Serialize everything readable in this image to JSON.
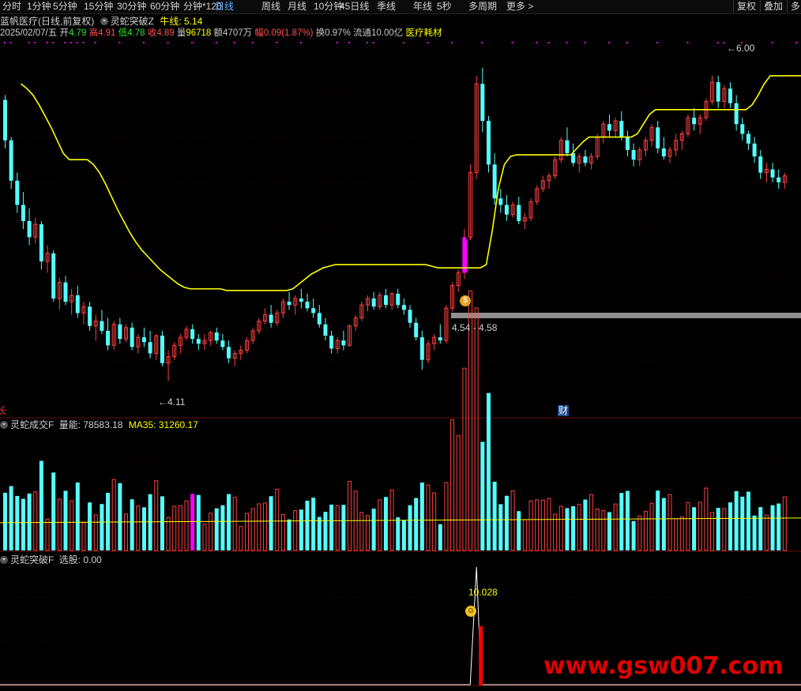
{
  "toolbar": {
    "tabs": [
      "分时",
      "1分钟",
      "5分钟",
      "15分钟",
      "30分钟",
      "60分钟",
      "分钟*120",
      "日线",
      "周线",
      "月线",
      "10分钟",
      "45日线",
      "季线",
      "年线",
      "5秒",
      "多周期",
      "更多"
    ],
    "active": "日线",
    "more_arrow": ">",
    "right_buttons": [
      "复权",
      "叠加",
      "多"
    ]
  },
  "header": {
    "stock": "蓝帆医疗(日线,前复权)",
    "indicator": "灵蛇突破Z",
    "bull_label": "牛线:",
    "bull_value": "5.14",
    "date": "2025/02/07/五",
    "open_label": "开",
    "open": "4.79",
    "high_label": "高",
    "high": "4.91",
    "low_label": "低",
    "low": "4.78",
    "close_label": "收",
    "close": "4.89",
    "vol_label": "量",
    "vol": "96718",
    "amount_label": "额",
    "amount": "4707万",
    "change_label": "幅",
    "change": "0.09(1.87%)",
    "turnover_label": "换",
    "turnover": "0.97%",
    "float_label": "流通",
    "float": "10.00亿",
    "sector": "医疗耗材"
  },
  "annotations": {
    "high_price": "6.00",
    "low_price": "4.11",
    "band": "4.54 - 4.58",
    "cai": "财",
    "left_mark": "长"
  },
  "volume_panel": {
    "indicator": "灵蛇成交F",
    "vol_label": "量能:",
    "vol_value": "78583.18",
    "ma_label": "MA35:",
    "ma_value": "31260.17"
  },
  "signal_panel": {
    "indicator": "灵蛇突破F",
    "pick_label": "选股:",
    "pick_value": "0.00",
    "peak_value": "10.028"
  },
  "watermark": "www.gsw007.com",
  "colors": {
    "up": "#ff4040",
    "down": "#54ffff",
    "bull_line": "#ffff00",
    "signal_bar": "#ff00ff",
    "grid": "#5a0a0a"
  },
  "chart_data": {
    "type": "candlestick",
    "price_range": [
      3.95,
      6.2
    ],
    "ohlc": [
      [
        5.85,
        5.88,
        5.55,
        5.6
      ],
      [
        5.6,
        5.62,
        5.3,
        5.35
      ],
      [
        5.35,
        5.4,
        5.15,
        5.2
      ],
      [
        5.2,
        5.28,
        5.05,
        5.1
      ],
      [
        5.1,
        5.18,
        4.95,
        5.0
      ],
      [
        5.0,
        5.12,
        4.96,
        5.08
      ],
      [
        5.08,
        5.1,
        4.8,
        4.85
      ],
      [
        4.85,
        4.95,
        4.78,
        4.9
      ],
      [
        4.9,
        4.92,
        4.6,
        4.62
      ],
      [
        4.62,
        4.75,
        4.55,
        4.72
      ],
      [
        4.72,
        4.76,
        4.58,
        4.6
      ],
      [
        4.6,
        4.68,
        4.52,
        4.64
      ],
      [
        4.64,
        4.7,
        4.5,
        4.53
      ],
      [
        4.53,
        4.6,
        4.46,
        4.57
      ],
      [
        4.57,
        4.6,
        4.42,
        4.45
      ],
      [
        4.45,
        4.52,
        4.36,
        4.48
      ],
      [
        4.48,
        4.55,
        4.4,
        4.42
      ],
      [
        4.42,
        4.5,
        4.3,
        4.33
      ],
      [
        4.33,
        4.48,
        4.3,
        4.46
      ],
      [
        4.46,
        4.5,
        4.34,
        4.37
      ],
      [
        4.37,
        4.46,
        4.35,
        4.44
      ],
      [
        4.44,
        4.47,
        4.3,
        4.32
      ],
      [
        4.32,
        4.4,
        4.28,
        4.38
      ],
      [
        4.38,
        4.44,
        4.32,
        4.35
      ],
      [
        4.35,
        4.42,
        4.25,
        4.28
      ],
      [
        4.28,
        4.4,
        4.24,
        4.39
      ],
      [
        4.39,
        4.42,
        4.2,
        4.22
      ],
      [
        4.22,
        4.3,
        4.11,
        4.26
      ],
      [
        4.26,
        4.35,
        4.24,
        4.33
      ],
      [
        4.33,
        4.4,
        4.28,
        4.38
      ],
      [
        4.38,
        4.45,
        4.36,
        4.43
      ],
      [
        4.43,
        4.46,
        4.34,
        4.37
      ],
      [
        4.37,
        4.4,
        4.3,
        4.34
      ],
      [
        4.34,
        4.4,
        4.3,
        4.36
      ],
      [
        4.36,
        4.42,
        4.33,
        4.41
      ],
      [
        4.41,
        4.44,
        4.34,
        4.36
      ],
      [
        4.36,
        4.4,
        4.3,
        4.32
      ],
      [
        4.32,
        4.36,
        4.22,
        4.25
      ],
      [
        4.25,
        4.3,
        4.2,
        4.28
      ],
      [
        4.28,
        4.33,
        4.24,
        4.3
      ],
      [
        4.3,
        4.38,
        4.28,
        4.36
      ],
      [
        4.36,
        4.44,
        4.34,
        4.42
      ],
      [
        4.42,
        4.5,
        4.4,
        4.48
      ],
      [
        4.48,
        4.56,
        4.46,
        4.52
      ],
      [
        4.52,
        4.58,
        4.44,
        4.47
      ],
      [
        4.47,
        4.55,
        4.45,
        4.53
      ],
      [
        4.53,
        4.62,
        4.5,
        4.6
      ],
      [
        4.6,
        4.66,
        4.55,
        4.58
      ],
      [
        4.58,
        4.64,
        4.52,
        4.62
      ],
      [
        4.62,
        4.68,
        4.56,
        4.6
      ],
      [
        4.6,
        4.65,
        4.54,
        4.56
      ],
      [
        4.56,
        4.62,
        4.5,
        4.53
      ],
      [
        4.53,
        4.58,
        4.44,
        4.46
      ],
      [
        4.46,
        4.5,
        4.36,
        4.39
      ],
      [
        4.39,
        4.42,
        4.28,
        4.31
      ],
      [
        4.31,
        4.38,
        4.28,
        4.36
      ],
      [
        4.36,
        4.42,
        4.3,
        4.33
      ],
      [
        4.33,
        4.46,
        4.32,
        4.45
      ],
      [
        4.45,
        4.52,
        4.42,
        4.5
      ],
      [
        4.5,
        4.6,
        4.48,
        4.58
      ],
      [
        4.58,
        4.64,
        4.54,
        4.62
      ],
      [
        4.62,
        4.66,
        4.55,
        4.57
      ],
      [
        4.57,
        4.66,
        4.55,
        4.64
      ],
      [
        4.64,
        4.68,
        4.56,
        4.58
      ],
      [
        4.58,
        4.66,
        4.55,
        4.65
      ],
      [
        4.65,
        4.68,
        4.56,
        4.58
      ],
      [
        4.58,
        4.62,
        4.52,
        4.55
      ],
      [
        4.55,
        4.58,
        4.44,
        4.47
      ],
      [
        4.47,
        4.5,
        4.36,
        4.38
      ],
      [
        4.38,
        4.42,
        4.18,
        4.24
      ],
      [
        4.24,
        4.36,
        4.22,
        4.34
      ],
      [
        4.34,
        4.4,
        4.3,
        4.38
      ],
      [
        4.38,
        4.46,
        4.34,
        4.36
      ],
      [
        4.36,
        4.58,
        4.34,
        4.56
      ],
      [
        4.56,
        4.72,
        4.54,
        4.7
      ],
      [
        4.7,
        4.8,
        4.66,
        4.78
      ],
      [
        4.78,
        5.05,
        4.74,
        5.0
      ],
      [
        5.0,
        5.45,
        4.98,
        5.4
      ],
      [
        5.4,
        6.0,
        5.36,
        5.95
      ],
      [
        5.95,
        6.05,
        5.65,
        5.72
      ],
      [
        5.72,
        5.75,
        5.4,
        5.45
      ],
      [
        5.45,
        5.52,
        5.2,
        5.24
      ],
      [
        5.24,
        5.3,
        5.15,
        5.2
      ],
      [
        5.2,
        5.26,
        5.1,
        5.14
      ],
      [
        5.14,
        5.22,
        5.12,
        5.2
      ],
      [
        5.2,
        5.25,
        5.08,
        5.1
      ],
      [
        5.1,
        5.15,
        5.05,
        5.12
      ],
      [
        5.12,
        5.24,
        5.1,
        5.22
      ],
      [
        5.22,
        5.32,
        5.2,
        5.3
      ],
      [
        5.3,
        5.38,
        5.28,
        5.35
      ],
      [
        5.35,
        5.4,
        5.3,
        5.38
      ],
      [
        5.38,
        5.5,
        5.36,
        5.48
      ],
      [
        5.48,
        5.62,
        5.46,
        5.6
      ],
      [
        5.6,
        5.68,
        5.5,
        5.52
      ],
      [
        5.52,
        5.58,
        5.44,
        5.46
      ],
      [
        5.46,
        5.52,
        5.4,
        5.5
      ],
      [
        5.5,
        5.54,
        5.44,
        5.46
      ],
      [
        5.46,
        5.52,
        5.42,
        5.5
      ],
      [
        5.5,
        5.64,
        5.48,
        5.62
      ],
      [
        5.62,
        5.72,
        5.58,
        5.7
      ],
      [
        5.7,
        5.76,
        5.62,
        5.66
      ],
      [
        5.66,
        5.74,
        5.62,
        5.72
      ],
      [
        5.72,
        5.78,
        5.6,
        5.62
      ],
      [
        5.62,
        5.66,
        5.5,
        5.54
      ],
      [
        5.54,
        5.58,
        5.44,
        5.48
      ],
      [
        5.48,
        5.56,
        5.44,
        5.54
      ],
      [
        5.54,
        5.62,
        5.5,
        5.6
      ],
      [
        5.6,
        5.7,
        5.56,
        5.68
      ],
      [
        5.68,
        5.72,
        5.52,
        5.55
      ],
      [
        5.55,
        5.62,
        5.48,
        5.5
      ],
      [
        5.5,
        5.56,
        5.46,
        5.54
      ],
      [
        5.54,
        5.64,
        5.5,
        5.6
      ],
      [
        5.6,
        5.66,
        5.54,
        5.64
      ],
      [
        5.64,
        5.76,
        5.62,
        5.74
      ],
      [
        5.74,
        5.8,
        5.66,
        5.7
      ],
      [
        5.7,
        5.76,
        5.64,
        5.74
      ],
      [
        5.74,
        5.86,
        5.72,
        5.84
      ],
      [
        5.84,
        6.0,
        5.82,
        5.96
      ],
      [
        5.96,
        6.0,
        5.8,
        5.84
      ],
      [
        5.84,
        5.94,
        5.8,
        5.92
      ],
      [
        5.92,
        5.96,
        5.8,
        5.83
      ],
      [
        5.83,
        5.88,
        5.66,
        5.7
      ],
      [
        5.7,
        5.74,
        5.6,
        5.64
      ],
      [
        5.64,
        5.66,
        5.54,
        5.58
      ],
      [
        5.58,
        5.62,
        5.46,
        5.5
      ],
      [
        5.5,
        5.54,
        5.36,
        5.4
      ],
      [
        5.4,
        5.46,
        5.34,
        5.42
      ],
      [
        5.42,
        5.46,
        5.34,
        5.37
      ],
      [
        5.37,
        5.42,
        5.3,
        5.34
      ],
      [
        5.34,
        5.4,
        5.3,
        5.38
      ]
    ],
    "bull_line": [
      5.95,
      5.92,
      5.88,
      5.82,
      5.75,
      5.68,
      5.6,
      5.52,
      5.48,
      5.48,
      5.48,
      5.48,
      5.45,
      5.4,
      5.33,
      5.25,
      5.17,
      5.1,
      5.03,
      4.97,
      4.92,
      4.88,
      4.84,
      4.8,
      4.77,
      4.74,
      4.71,
      4.69,
      4.68,
      4.68,
      4.68,
      4.68,
      4.68,
      4.68,
      4.67,
      4.67,
      4.67,
      4.67,
      4.67,
      4.67,
      4.67,
      4.67,
      4.67,
      4.67,
      4.67,
      4.68,
      4.71,
      4.74,
      4.77,
      4.79,
      4.81,
      4.82,
      4.83,
      4.83,
      4.83,
      4.83,
      4.83,
      4.83,
      4.83,
      4.83,
      4.83,
      4.83,
      4.83,
      4.83,
      4.83,
      4.83,
      4.83,
      4.83,
      4.82,
      4.81,
      4.81,
      4.81,
      4.81,
      4.81,
      4.81,
      4.81,
      4.81,
      4.83,
      5.04,
      5.3,
      5.45,
      5.5,
      5.51,
      5.51,
      5.51,
      5.51,
      5.51,
      5.51,
      5.51,
      5.51,
      5.51,
      5.51,
      5.55,
      5.59,
      5.62,
      5.62,
      5.62,
      5.62,
      5.62,
      5.62,
      5.62,
      5.62,
      5.64,
      5.7,
      5.76,
      5.79,
      5.79,
      5.79,
      5.79,
      5.79,
      5.79,
      5.79,
      5.79,
      5.79,
      5.79,
      5.79,
      5.79,
      5.79,
      5.79,
      5.79,
      5.79,
      5.82,
      5.88,
      5.95,
      6.0,
      6.0,
      6.0,
      6.0,
      6.0,
      6.0,
      6.0,
      6.0,
      6.0
    ],
    "volume_ma35": 31260.17,
    "signal_peak_index": 78
  }
}
